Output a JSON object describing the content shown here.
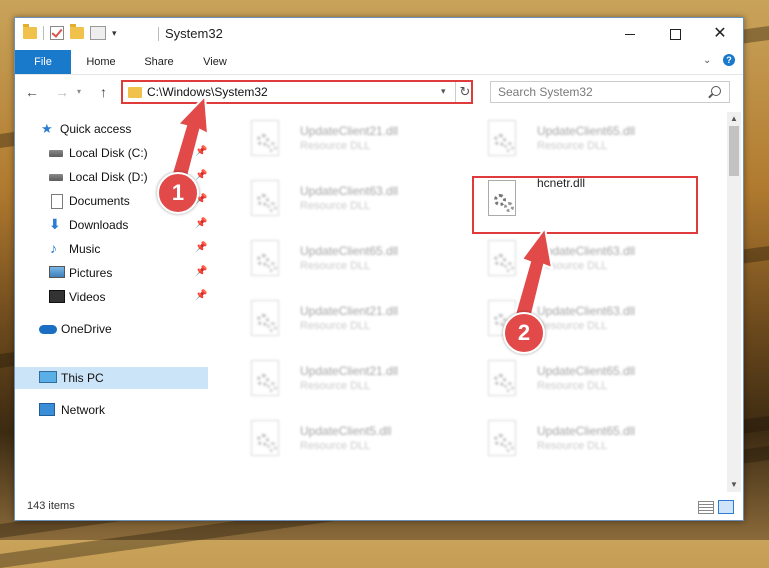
{
  "window": {
    "title": "System32",
    "controls": {
      "minimize": "minimize",
      "maximize": "maximize",
      "close": "✕"
    }
  },
  "ribbon": {
    "tabs": [
      "File",
      "Home",
      "Share",
      "View"
    ]
  },
  "address": {
    "path": "C:\\Windows\\System32",
    "search_placeholder": "Search System32"
  },
  "sidebar": {
    "items": [
      {
        "label": "Quick access",
        "icon": "star-icon",
        "pinned": false
      },
      {
        "label": "Local Disk (C:)",
        "icon": "drive-icon",
        "pinned": true
      },
      {
        "label": "Local Disk (D:)",
        "icon": "drive-icon",
        "pinned": true
      },
      {
        "label": "Documents",
        "icon": "documents-icon",
        "pinned": true
      },
      {
        "label": "Downloads",
        "icon": "download-arrow-icon",
        "pinned": true
      },
      {
        "label": "Music",
        "icon": "music-note-icon",
        "pinned": true
      },
      {
        "label": "Pictures",
        "icon": "pictures-icon",
        "pinned": true
      },
      {
        "label": "Videos",
        "icon": "videos-icon",
        "pinned": true
      },
      {
        "label": "OneDrive",
        "icon": "cloud-icon",
        "pinned": false
      },
      {
        "label": "This PC",
        "icon": "computer-icon",
        "pinned": false,
        "selected": true
      },
      {
        "label": "Network",
        "icon": "network-icon",
        "pinned": false
      }
    ]
  },
  "files": {
    "left_column": [
      {
        "name": "UpdateClient21.dll",
        "type": "Resource DLL"
      },
      {
        "name": "UpdateClient63.dll",
        "type": "Resource DLL"
      },
      {
        "name": "UpdateClient65.dll",
        "type": "Resource DLL"
      },
      {
        "name": "UpdateClient21.dll",
        "type": "Resource DLL"
      },
      {
        "name": "UpdateClient21.dll",
        "type": "Resource DLL"
      },
      {
        "name": "UpdateClient5.dll",
        "type": "Resource DLL"
      }
    ],
    "right_column": [
      {
        "name": "UpdateClient65.dll",
        "type": "Resource DLL"
      },
      {
        "name": "hcnetr.dll",
        "type": "",
        "highlighted": true
      },
      {
        "name": "UpdateClient63.dll",
        "type": "Resource DLL"
      },
      {
        "name": "UpdateClient63.dll",
        "type": "Resource DLL"
      },
      {
        "name": "UpdateClient65.dll",
        "type": "Resource DLL"
      },
      {
        "name": "UpdateClient65.dll",
        "type": "Resource DLL"
      }
    ]
  },
  "status": {
    "item_count": "143 items"
  },
  "callouts": {
    "step1": "1",
    "step2": "2"
  },
  "colors": {
    "accent": "#1979ca",
    "highlight_red": "#e03b3b",
    "selected_bg": "#cce4f7"
  }
}
